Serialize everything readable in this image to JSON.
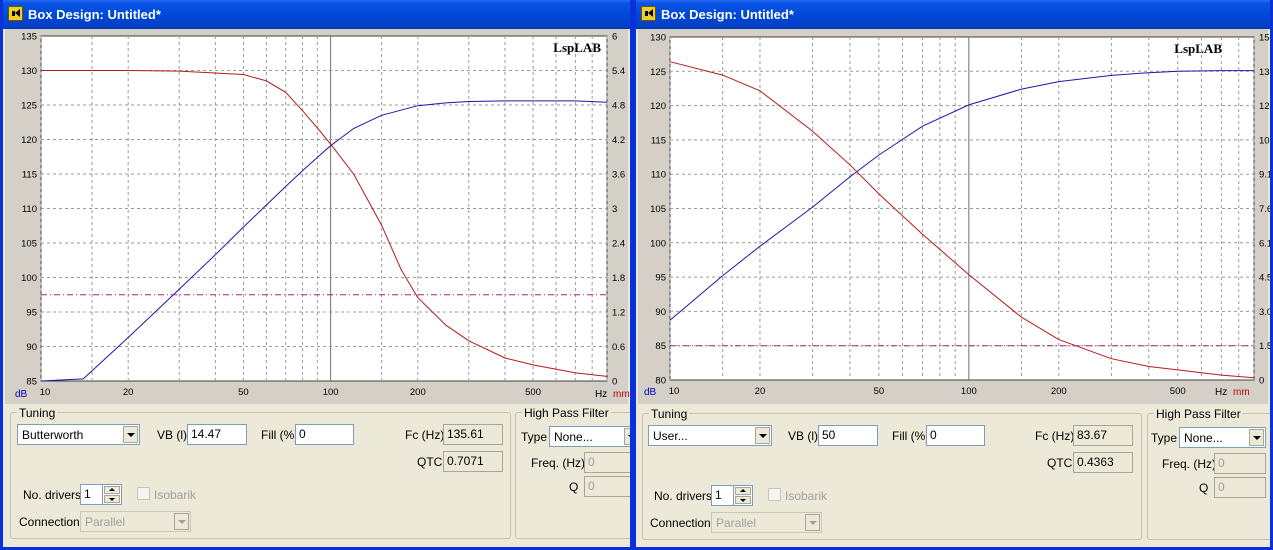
{
  "colors": {
    "titlebar": "#0049d8",
    "spl_curve": "#1a1aa6",
    "excursion_curve": "#b31b1b",
    "limit_line": "#b0207a",
    "chart_background": "#ffffff"
  },
  "windows": [
    {
      "title": "Box Design: Untitled*",
      "graph": {
        "watermark": "LspLAB",
        "left_unit": "dB",
        "freq_unit": "Hz",
        "right_unit": "mm",
        "left_ticks": [
          "135",
          "130",
          "125",
          "120",
          "115",
          "110",
          "105",
          "100",
          "95",
          "90",
          "85"
        ],
        "right_ticks": [
          "6",
          "5.4",
          "4.8",
          "4.2",
          "3.6",
          "3",
          "2.4",
          "1.8",
          "1.2",
          "0.6",
          "0"
        ],
        "x_ticks": [
          "10",
          "20",
          "50",
          "100",
          "200",
          "500"
        ]
      },
      "panel": {
        "tuning_legend": "Tuning",
        "alignment": "Butterworth",
        "vb_label": "VB (l)",
        "vb_value": "14.47",
        "fill_label": "Fill (%)",
        "fill_value": "0",
        "fc_label": "Fc (Hz)",
        "fc_value": "135.61",
        "qtc_label": "QTC",
        "qtc_value": "0.7071",
        "drivers_label": "No. drivers",
        "drivers_value": "1",
        "isobarik_label": "Isobarik",
        "connection_label": "Connection",
        "connection_value": "Parallel",
        "hpf_legend": "High Pass Filter",
        "type_label": "Type",
        "type_value": "None...",
        "freq_label": "Freq. (Hz)",
        "freq_value": "0",
        "q_label": "Q",
        "q_value": "0"
      }
    },
    {
      "title": "Box Design: Untitled*",
      "graph": {
        "watermark": "LspLAB",
        "left_unit": "dB",
        "freq_unit": "Hz",
        "right_unit": "mm",
        "left_ticks": [
          "130",
          "125",
          "120",
          "115",
          "110",
          "105",
          "100",
          "95",
          "90",
          "85",
          "80"
        ],
        "right_ticks": [
          "15.3",
          "13.77",
          "12.24",
          "10.71",
          "9.18",
          "7.65",
          "6.12",
          "4.59",
          "3.06",
          "1.53",
          "0"
        ],
        "x_ticks": [
          "10",
          "20",
          "50",
          "100",
          "200",
          "500"
        ]
      },
      "panel": {
        "tuning_legend": "Tuning",
        "alignment": "User...",
        "vb_label": "VB (l)",
        "vb_value": "50",
        "fill_label": "Fill (%)",
        "fill_value": "0",
        "fc_label": "Fc (Hz)",
        "fc_value": "83.67",
        "qtc_label": "QTC",
        "qtc_value": "0.4363",
        "drivers_label": "No. drivers",
        "drivers_value": "1",
        "isobarik_label": "Isobarik",
        "connection_label": "Connection",
        "connection_value": "Parallel",
        "hpf_legend": "High Pass Filter",
        "type_label": "Type",
        "type_value": "None...",
        "freq_label": "Freq. (Hz)",
        "freq_value": "0",
        "q_label": "Q",
        "q_value": "0"
      }
    }
  ],
  "chart_data": [
    {
      "type": "line",
      "x_scale": "log",
      "xlim": [
        10,
        900
      ],
      "ylim": [
        85,
        135
      ],
      "y2lim": [
        0,
        6
      ],
      "xlabel": "Hz",
      "ylabel": "dB",
      "y2label": "mm",
      "grid": true,
      "x_gridlines": [
        10,
        15,
        20,
        30,
        40,
        50,
        60,
        70,
        80,
        90,
        100,
        150,
        200,
        300,
        400,
        500,
        600,
        700,
        800,
        900
      ],
      "series": [
        {
          "axis": "left",
          "color": "#1a1aa6",
          "x": [
            10,
            14,
            20,
            30,
            40,
            50,
            60,
            70,
            80,
            90,
            100,
            120,
            150,
            200,
            250,
            300,
            400,
            500,
            700,
            900
          ],
          "y": [
            83,
            85.3,
            91.3,
            98.3,
            103.3,
            107.3,
            110.5,
            113.2,
            115.5,
            117.4,
            119.1,
            121.6,
            123.5,
            124.9,
            125.3,
            125.5,
            125.6,
            125.6,
            125.6,
            125.4
          ]
        },
        {
          "axis": "right",
          "color": "#b31b1b",
          "x": [
            10,
            20,
            30,
            50,
            60,
            70,
            80,
            90,
            100,
            120,
            150,
            175,
            200,
            250,
            300,
            400,
            500,
            700,
            900
          ],
          "y": [
            5.4,
            5.4,
            5.39,
            5.33,
            5.22,
            5.02,
            4.7,
            4.4,
            4.12,
            3.6,
            2.71,
            1.94,
            1.45,
            0.97,
            0.7,
            0.4,
            0.28,
            0.14,
            0.08
          ]
        },
        {
          "axis": "right",
          "color": "#b0207a",
          "dashed": true,
          "x": [
            10,
            900
          ],
          "y": [
            1.5,
            1.5
          ]
        }
      ]
    },
    {
      "type": "line",
      "x_scale": "log",
      "xlim": [
        10,
        900
      ],
      "ylim": [
        80,
        130
      ],
      "y2lim": [
        0,
        15.3
      ],
      "xlabel": "Hz",
      "ylabel": "dB",
      "y2label": "mm",
      "grid": true,
      "x_gridlines": [
        10,
        15,
        20,
        30,
        40,
        50,
        60,
        70,
        80,
        90,
        100,
        150,
        200,
        300,
        400,
        500,
        600,
        700,
        800,
        900
      ],
      "series": [
        {
          "axis": "left",
          "color": "#1a1aa6",
          "x": [
            10,
            15,
            20,
            30,
            40,
            50,
            70,
            100,
            150,
            200,
            300,
            400,
            500,
            700,
            900
          ],
          "y": [
            88.7,
            95.2,
            99.5,
            105.2,
            109.6,
            112.8,
            117,
            120.1,
            122.4,
            123.5,
            124.4,
            124.8,
            125,
            125.1,
            125.1
          ],
          "note": ""
        },
        {
          "axis": "right",
          "color": "#b31b1b",
          "x": [
            10,
            15,
            20,
            30,
            40,
            50,
            70,
            100,
            150,
            200,
            300,
            400,
            500,
            700,
            900
          ],
          "y": [
            14.2,
            13.6,
            12.9,
            11.1,
            9.6,
            8.3,
            6.5,
            4.7,
            2.8,
            1.8,
            0.95,
            0.6,
            0.45,
            0.22,
            0.1
          ]
        },
        {
          "axis": "right",
          "color": "#b0207a",
          "dashed": true,
          "x": [
            10,
            900
          ],
          "y": [
            1.53,
            1.53
          ]
        }
      ]
    }
  ]
}
